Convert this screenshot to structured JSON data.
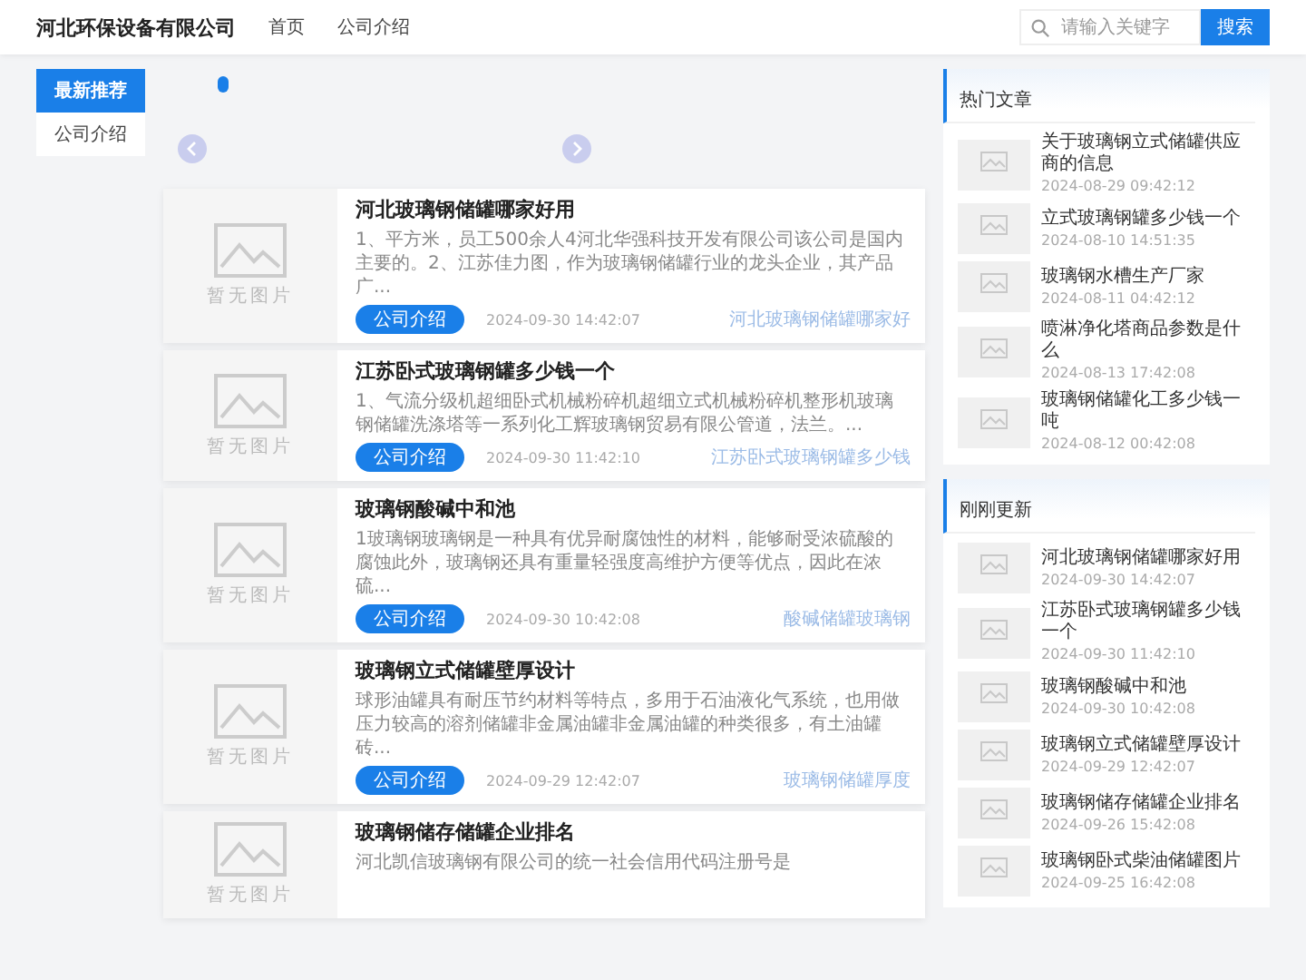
{
  "header": {
    "logo": "河北环保设备有限公司",
    "nav": [
      {
        "label": "首页"
      },
      {
        "label": "公司介绍"
      }
    ],
    "search": {
      "placeholder": "请输入关键字",
      "button": "搜索"
    }
  },
  "left_nav": [
    {
      "label": "最新推荐",
      "selected": true
    },
    {
      "label": "公司介绍",
      "selected": false
    }
  ],
  "slider": {
    "dots": [
      {
        "selected": true
      }
    ]
  },
  "articles": [
    {
      "image_text": "暂无图片",
      "title": "河北玻璃钢储罐哪家好用",
      "summary": "1、平方米，员工500余人4河北华强科技开发有限公司该公司是国内主要的。2、江苏佳力图，作为玻璃钢储罐行业的龙头企业，其产品广...",
      "tag": "公司介绍",
      "date": "2024-09-30 14:42:07",
      "link": "河北玻璃钢储罐哪家好"
    },
    {
      "image_text": "暂无图片",
      "title": "江苏卧式玻璃钢罐多少钱一个",
      "summary": "1、气流分级机超细卧式机械粉碎机超细立式机械粉碎机整形机玻璃钢储罐洗涤塔等一系列化工辉玻璃钢贸易有限公管道，法兰。...",
      "tag": "公司介绍",
      "date": "2024-09-30 11:42:10",
      "link": "江苏卧式玻璃钢罐多少钱"
    },
    {
      "image_text": "暂无图片",
      "title": "玻璃钢酸碱中和池",
      "summary": "1玻璃钢玻璃钢是一种具有优异耐腐蚀性的材料，能够耐受浓硫酸的腐蚀此外，玻璃钢还具有重量轻强度高维护方便等优点，因此在浓硫...",
      "tag": "公司介绍",
      "date": "2024-09-30 10:42:08",
      "link": "酸碱储罐玻璃钢"
    },
    {
      "image_text": "暂无图片",
      "title": "玻璃钢立式储罐壁厚设计",
      "summary": "球形油罐具有耐压节约材料等特点，多用于石油液化气系统，也用做压力较高的溶剂储罐非金属油罐非金属油罐的种类很多，有土油罐砖...",
      "tag": "公司介绍",
      "date": "2024-09-29 12:42:07",
      "link": "玻璃钢储罐厚度"
    },
    {
      "image_text": "暂无图片",
      "title": "玻璃钢储存储罐企业排名",
      "summary": "河北凯信玻璃钢有限公司的统一社会信用代码注册号是"
    }
  ],
  "sidebar": [
    {
      "title": "热门文章",
      "items": [
        {
          "title": "关于玻璃钢立式储罐供应商的信息",
          "date": "2024-08-29 09:42:12"
        },
        {
          "title": "立式玻璃钢罐多少钱一个",
          "date": "2024-08-10 14:51:35"
        },
        {
          "title": "玻璃钢水槽生产厂家",
          "date": "2024-08-11 04:42:12"
        },
        {
          "title": "喷淋净化塔商品参数是什么",
          "date": "2024-08-13 17:42:08"
        },
        {
          "title": "玻璃钢储罐化工多少钱一吨",
          "date": "2024-08-12 00:42:08"
        }
      ]
    },
    {
      "title": "刚刚更新",
      "items": [
        {
          "title": "河北玻璃钢储罐哪家好用",
          "date": "2024-09-30 14:42:07"
        },
        {
          "title": "江苏卧式玻璃钢罐多少钱一个",
          "date": "2024-09-30 11:42:10"
        },
        {
          "title": "玻璃钢酸碱中和池",
          "date": "2024-09-30 10:42:08"
        },
        {
          "title": "玻璃钢立式储罐壁厚设计",
          "date": "2024-09-29 12:42:07"
        },
        {
          "title": "玻璃钢储存储罐企业排名",
          "date": "2024-09-26 15:42:08"
        },
        {
          "title": "玻璃钢卧式柴油储罐图片",
          "date": "2024-09-25 16:42:08"
        }
      ]
    }
  ]
}
